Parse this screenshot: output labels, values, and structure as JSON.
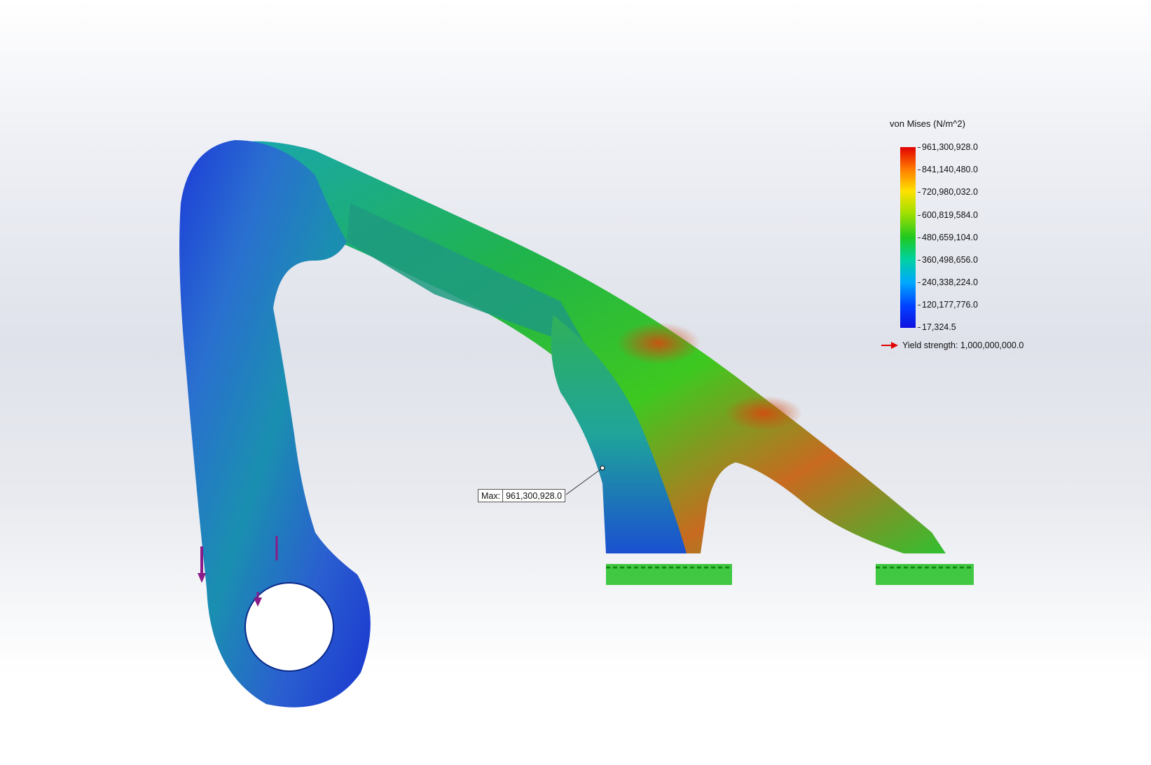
{
  "legend": {
    "title": "von Mises (N/m^2)",
    "labels": [
      "961,300,928.0",
      "841,140,480.0",
      "720,980,032.0",
      "600,819,584.0",
      "480,659,104.0",
      "360,498,656.0",
      "240,338,224.0",
      "120,177,776.0",
      "17,324.5"
    ],
    "yield_text": "Yield strength: 1,000,000,000.0",
    "yield_arrow_color": "#e00000"
  },
  "probe": {
    "label": "Max:",
    "value": "961,300,928.0"
  },
  "model": {
    "load_arrow_color": "#8a1c8a",
    "fixture_color": "#1fb81f"
  }
}
